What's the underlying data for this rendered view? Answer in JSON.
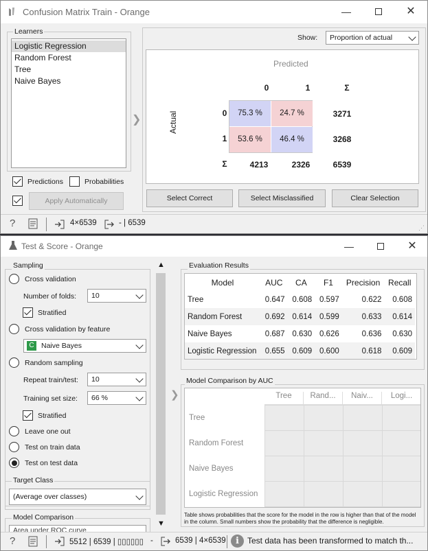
{
  "cm": {
    "title": "Confusion Matrix Train - Orange",
    "learners_label": "Learners",
    "learners": [
      "Logistic Regression",
      "Random Forest",
      "Tree",
      "Naive Bayes"
    ],
    "predictions_label": "Predictions",
    "probabilities_label": "Probabilities",
    "apply_label": "Apply Automatically",
    "show_label": "Show:",
    "show_value": "Proportion of actual",
    "predicted_label": "Predicted",
    "actual_label": "Actual",
    "col_headers": [
      "0",
      "1",
      "Σ"
    ],
    "row_headers": [
      "0",
      "1",
      "Σ"
    ],
    "cells": [
      "75.3 %",
      "24.7 %",
      "53.6 %",
      "46.4 %"
    ],
    "row_sums": [
      "3271",
      "3268"
    ],
    "col_sums": [
      "4213",
      "2326",
      "6539"
    ],
    "btn_correct": "Select Correct",
    "btn_misclassified": "Select Misclassified",
    "btn_clear": "Clear Selection",
    "status_in": "4×6539",
    "status_out": "- | 6539",
    "colors": {
      "correct": "#d2d4f5",
      "wrong": "#f5d2d4",
      "correct_dark": "#c4c6ef",
      "wrong_dark": "#efc4c6"
    }
  },
  "ts": {
    "title": "Test & Score - Orange",
    "sampling_label": "Sampling",
    "cross_validation": "Cross validation",
    "num_folds_label": "Number of folds:",
    "num_folds_value": "10",
    "stratified_1": "Stratified",
    "cv_by_feature": "Cross validation by feature",
    "feature_value": "Naive Bayes",
    "feature_badge": "C",
    "random_sampling": "Random sampling",
    "repeat_label": "Repeat train/test:",
    "repeat_value": "10",
    "train_size_label": "Training set size:",
    "train_size_value": "66 %",
    "stratified_2": "Stratified",
    "leave_one_out": "Leave one out",
    "test_on_train": "Test on train data",
    "test_on_test": "Test on test data",
    "target_class_label": "Target Class",
    "target_class_value": "(Average over classes)",
    "model_comparison_label": "Model Comparison",
    "model_comparison_value": "Area under ROC curve",
    "eval_label": "Evaluation Results",
    "eval_headers": [
      "Model",
      "AUC",
      "CA",
      "F1",
      "Precision",
      "Recall"
    ],
    "eval_rows": [
      [
        "Tree",
        "0.647",
        "0.608",
        "0.597",
        "0.622",
        "0.608"
      ],
      [
        "Random Forest",
        "0.692",
        "0.614",
        "0.599",
        "0.633",
        "0.614"
      ],
      [
        "Naive Bayes",
        "0.687",
        "0.630",
        "0.626",
        "0.636",
        "0.630"
      ],
      [
        "Logistic Regression",
        "0.655",
        "0.609",
        "0.600",
        "0.618",
        "0.609"
      ]
    ],
    "comparison_label": "Model Comparison by AUC",
    "comparison_cols": [
      "Tree",
      "Rand...",
      "Naiv...",
      "Logi..."
    ],
    "comparison_rows": [
      "Tree",
      "Random Forest",
      "Naive Bayes",
      "Logistic Regression"
    ],
    "comparison_note": "Table shows probabilities that the score for the model in the row is higher than that of the model in the column. Small numbers show the probability that the difference is negligible.",
    "status_in": "5512 | 6539 | ▯▯▯▯▯▯",
    "status_dash": "-",
    "status_out": "6539 | 4×6539",
    "status_info": "Test data has been transformed to match th..."
  }
}
